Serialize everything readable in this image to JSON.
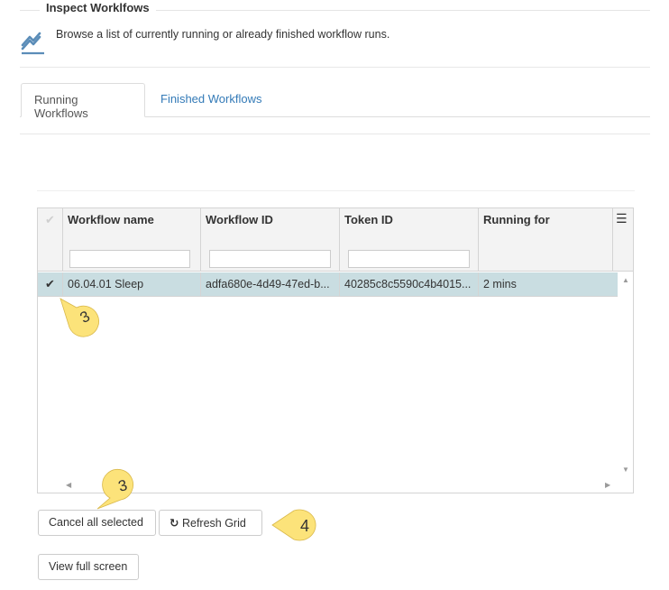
{
  "section": {
    "title": "Inspect Worklfows",
    "description": "Browse a list of currently running or already finished workflow runs.",
    "icon": "chart-line-icon",
    "accent_color": "#5b8db8"
  },
  "tabs": [
    {
      "label": "Running Workflows",
      "active": true
    },
    {
      "label": "Finished Workflows",
      "active": false
    }
  ],
  "grid": {
    "columns": [
      "Workflow name",
      "Workflow ID",
      "Token ID",
      "Running for"
    ],
    "rows": [
      {
        "selected": true,
        "cells": [
          "06.04.01 Sleep",
          "adfa680e-4d49-47ed-b...",
          "40285c8c5590c4b4015...",
          "2 mins"
        ]
      }
    ],
    "selected_row_color": "#c9dde1"
  },
  "callouts": [
    {
      "label": "3",
      "color": "#fce37a"
    },
    {
      "label": "3",
      "color": "#fce37a"
    },
    {
      "label": "4",
      "color": "#fce37a"
    }
  ],
  "buttons": {
    "cancel_selected": "Cancel all selected",
    "refresh_grid": "Refresh Grid",
    "view_full_screen": "View full screen"
  }
}
